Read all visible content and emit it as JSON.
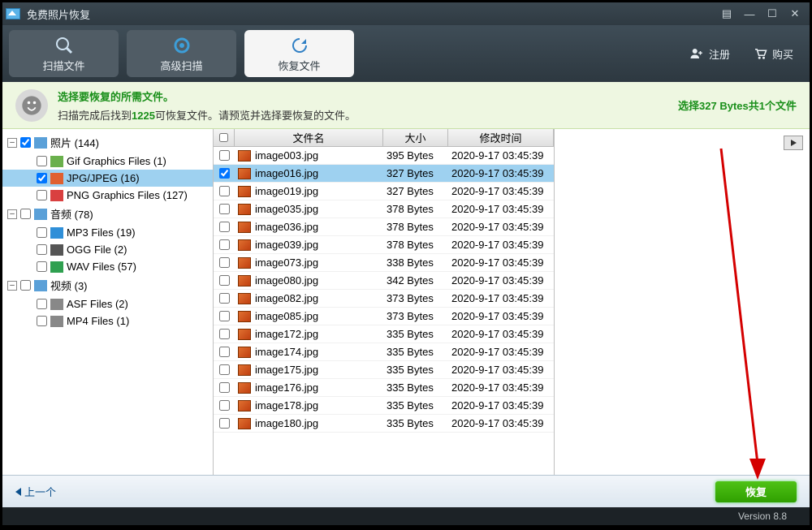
{
  "title": "免费照片恢复",
  "tabs": {
    "scan": "扫描文件",
    "adv": "高级扫描",
    "recover": "恢复文件"
  },
  "header_links": {
    "register": "注册",
    "buy": "购买"
  },
  "info": {
    "title": "选择要恢复的所需文件。",
    "prefix": "扫描完成后找到",
    "count": "1225",
    "suffix": "可恢复文件。请预览并选择要恢复的文件。",
    "selected": "选择327 Bytes共1个文件"
  },
  "tree": [
    {
      "indent": 0,
      "toggle": "–",
      "checked": true,
      "icon": "folder",
      "label": "照片 (144)"
    },
    {
      "indent": 1,
      "toggle": "",
      "checked": false,
      "icon": "gif",
      "label": "Gif Graphics Files (1)"
    },
    {
      "indent": 1,
      "toggle": "",
      "checked": true,
      "icon": "jpg",
      "label": "JPG/JPEG (16)",
      "selected": true
    },
    {
      "indent": 1,
      "toggle": "",
      "checked": false,
      "icon": "png",
      "label": "PNG Graphics Files (127)"
    },
    {
      "indent": 0,
      "toggle": "–",
      "checked": false,
      "icon": "folder",
      "label": "音频 (78)"
    },
    {
      "indent": 1,
      "toggle": "",
      "checked": false,
      "icon": "mp3",
      "label": "MP3 Files (19)"
    },
    {
      "indent": 1,
      "toggle": "",
      "checked": false,
      "icon": "ogg",
      "label": "OGG File (2)"
    },
    {
      "indent": 1,
      "toggle": "",
      "checked": false,
      "icon": "wav",
      "label": "WAV Files (57)"
    },
    {
      "indent": 0,
      "toggle": "–",
      "checked": false,
      "icon": "folder",
      "label": "视频 (3)"
    },
    {
      "indent": 1,
      "toggle": "",
      "checked": false,
      "icon": "asf",
      "label": "ASF Files (2)"
    },
    {
      "indent": 1,
      "toggle": "",
      "checked": false,
      "icon": "mp4",
      "label": "MP4 Files (1)"
    }
  ],
  "columns": {
    "name": "文件名",
    "size": "大小",
    "time": "修改时间"
  },
  "files": [
    {
      "checked": false,
      "name": "image003.jpg",
      "size": "395 Bytes",
      "time": "2020-9-17 03:45:39"
    },
    {
      "checked": true,
      "name": "image016.jpg",
      "size": "327 Bytes",
      "time": "2020-9-17 03:45:39",
      "selected": true
    },
    {
      "checked": false,
      "name": "image019.jpg",
      "size": "327 Bytes",
      "time": "2020-9-17 03:45:39"
    },
    {
      "checked": false,
      "name": "image035.jpg",
      "size": "378 Bytes",
      "time": "2020-9-17 03:45:39"
    },
    {
      "checked": false,
      "name": "image036.jpg",
      "size": "378 Bytes",
      "time": "2020-9-17 03:45:39"
    },
    {
      "checked": false,
      "name": "image039.jpg",
      "size": "378 Bytes",
      "time": "2020-9-17 03:45:39"
    },
    {
      "checked": false,
      "name": "image073.jpg",
      "size": "338 Bytes",
      "time": "2020-9-17 03:45:39"
    },
    {
      "checked": false,
      "name": "image080.jpg",
      "size": "342 Bytes",
      "time": "2020-9-17 03:45:39"
    },
    {
      "checked": false,
      "name": "image082.jpg",
      "size": "373 Bytes",
      "time": "2020-9-17 03:45:39"
    },
    {
      "checked": false,
      "name": "image085.jpg",
      "size": "373 Bytes",
      "time": "2020-9-17 03:45:39"
    },
    {
      "checked": false,
      "name": "image172.jpg",
      "size": "335 Bytes",
      "time": "2020-9-17 03:45:39"
    },
    {
      "checked": false,
      "name": "image174.jpg",
      "size": "335 Bytes",
      "time": "2020-9-17 03:45:39"
    },
    {
      "checked": false,
      "name": "image175.jpg",
      "size": "335 Bytes",
      "time": "2020-9-17 03:45:39"
    },
    {
      "checked": false,
      "name": "image176.jpg",
      "size": "335 Bytes",
      "time": "2020-9-17 03:45:39"
    },
    {
      "checked": false,
      "name": "image178.jpg",
      "size": "335 Bytes",
      "time": "2020-9-17 03:45:39"
    },
    {
      "checked": false,
      "name": "image180.jpg",
      "size": "335 Bytes",
      "time": "2020-9-17 03:45:39"
    }
  ],
  "buttons": {
    "prev": "上一个",
    "recover": "恢复"
  },
  "version": "Version 8.8"
}
